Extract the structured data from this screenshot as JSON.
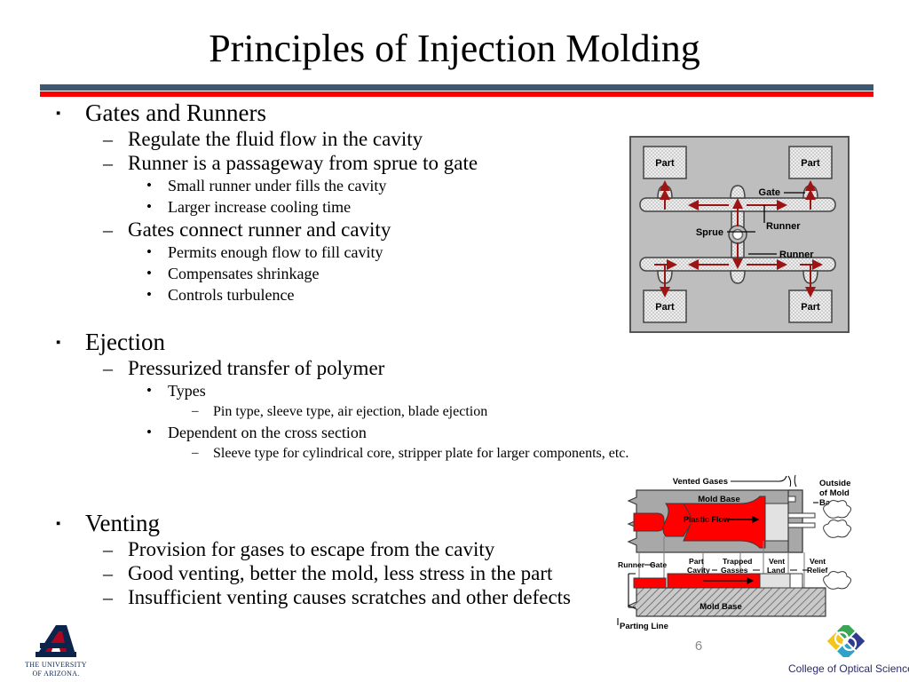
{
  "slide": {
    "title": "Principles of Injection Molding",
    "page_number": "6",
    "rule_top_color": "#3e5871",
    "rule_bottom_color": "#fa0000"
  },
  "content": [
    {
      "level": 1,
      "marker": "▪",
      "text": "Gates and Runners"
    },
    {
      "level": 2,
      "marker": "–",
      "text": "Regulate the fluid flow in the cavity"
    },
    {
      "level": 2,
      "marker": "–",
      "text": "Runner is a passageway from sprue to gate"
    },
    {
      "level": 3,
      "marker": "•",
      "text": "Small runner under fills the cavity"
    },
    {
      "level": 3,
      "marker": "•",
      "text": "Larger increase cooling time"
    },
    {
      "level": 2,
      "marker": "–",
      "text": "Gates connect runner and cavity"
    },
    {
      "level": 3,
      "marker": "•",
      "text": "Permits enough flow to fill cavity"
    },
    {
      "level": 3,
      "marker": "•",
      "text": "Compensates shrinkage"
    },
    {
      "level": 3,
      "marker": "•",
      "text": "Controls turbulence"
    },
    {
      "level": 0,
      "marker": "",
      "text": ""
    },
    {
      "level": 1,
      "marker": "▪",
      "text": "Ejection"
    },
    {
      "level": 2,
      "marker": "–",
      "text": "Pressurized transfer of polymer"
    },
    {
      "level": 3,
      "marker": "•",
      "text": "Types"
    },
    {
      "level": 4,
      "marker": "–",
      "text": "Pin type, sleeve type, air ejection, blade ejection"
    },
    {
      "level": 3,
      "marker": "•",
      "text": "Dependent on the cross section"
    },
    {
      "level": 4,
      "marker": "–",
      "text": "Sleeve type for cylindrical core, stripper plate for larger components, etc."
    },
    {
      "level": 0,
      "marker": "",
      "text": ""
    },
    {
      "level": 0,
      "marker": "",
      "text": ""
    },
    {
      "level": 1,
      "marker": "▪",
      "text": "Venting"
    },
    {
      "level": 2,
      "marker": "–",
      "text": "Provision for gases to escape from the cavity"
    },
    {
      "level": 2,
      "marker": "–",
      "text": "Good venting, better the mold, less stress in the part"
    },
    {
      "level": 2,
      "marker": "–",
      "text": "Insufficient venting causes scratches and other defects"
    }
  ],
  "figure_runner": {
    "caption_labels": {
      "part_top_left": "Part",
      "part_top_right": "Part",
      "part_bottom_left": "Part",
      "part_bottom_right": "Part",
      "gate": "Gate",
      "sprue": "Sprue",
      "runner_upper": "Runner",
      "runner_lower": "Runner"
    },
    "colors": {
      "background": "#bebebe",
      "border": "#555555",
      "channel_fill": "#d6d6d6",
      "flow_arrow": "#9c1414"
    }
  },
  "figure_venting": {
    "labels": {
      "vented_gases": "Vented Gases",
      "mold_base_top": "Mold Base",
      "mold_base_bottom": "Mold Base",
      "plastic_flow": "Plastic Flow",
      "outside_of_mold_base": "Outside of Mold Base",
      "runner": "Runner",
      "gate": "Gate",
      "part_cavity": "Part Cavity",
      "trapped_gasses": "Trapped Gasses",
      "vent_land": "Vent Land",
      "vent_relief": "Vent Relief",
      "parting_line": "Parting Line"
    },
    "colors": {
      "plastic": "#ff0000",
      "mold": "#a8a8a8",
      "trapped": "#e2e2e2"
    }
  },
  "logos": {
    "arizona": {
      "line1": "The University",
      "line2": "of Arizona.",
      "navy": "#0c234b",
      "red": "#ab0520"
    },
    "optical_sciences": {
      "label": "College of Optical Sciences",
      "text_color": "#2c2a6b"
    }
  }
}
